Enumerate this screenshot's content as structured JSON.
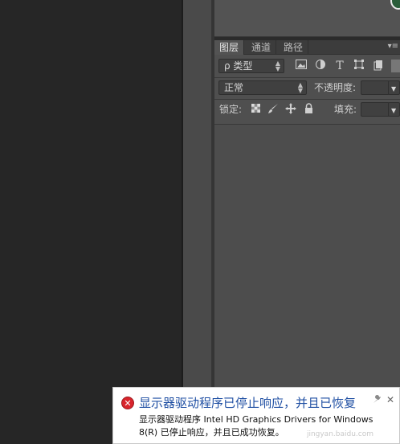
{
  "layers_panel": {
    "tabs": [
      "图层",
      "通道",
      "路径"
    ],
    "tab_menu": "▾≡",
    "filter": {
      "kind_label": "ρ 类型"
    },
    "filter_icons": [
      "image-filter-icon",
      "adjustment-filter-icon",
      "type-filter-icon",
      "shape-filter-icon",
      "smart-object-filter-icon"
    ],
    "filter_type_glyph": "T",
    "blend_mode": "正常",
    "opacity_label": "不透明度:",
    "lock_label": "锁定:",
    "fill_label": "填充:"
  },
  "notification": {
    "title": "显示器驱动程序已停止响应，并且已恢复",
    "body": "显示器驱动程序 Intel HD Graphics Drivers for Windows 8(R) 已停止响应，并且已成功恢复。",
    "watermark": "jingyan.baidu.com",
    "close_glyph": "✕"
  },
  "colors": {
    "canvas_bg": "#262626",
    "panel_bg": "#4f4f4f",
    "notification_title": "#1f4fa3",
    "error_icon": "#d8242c"
  }
}
